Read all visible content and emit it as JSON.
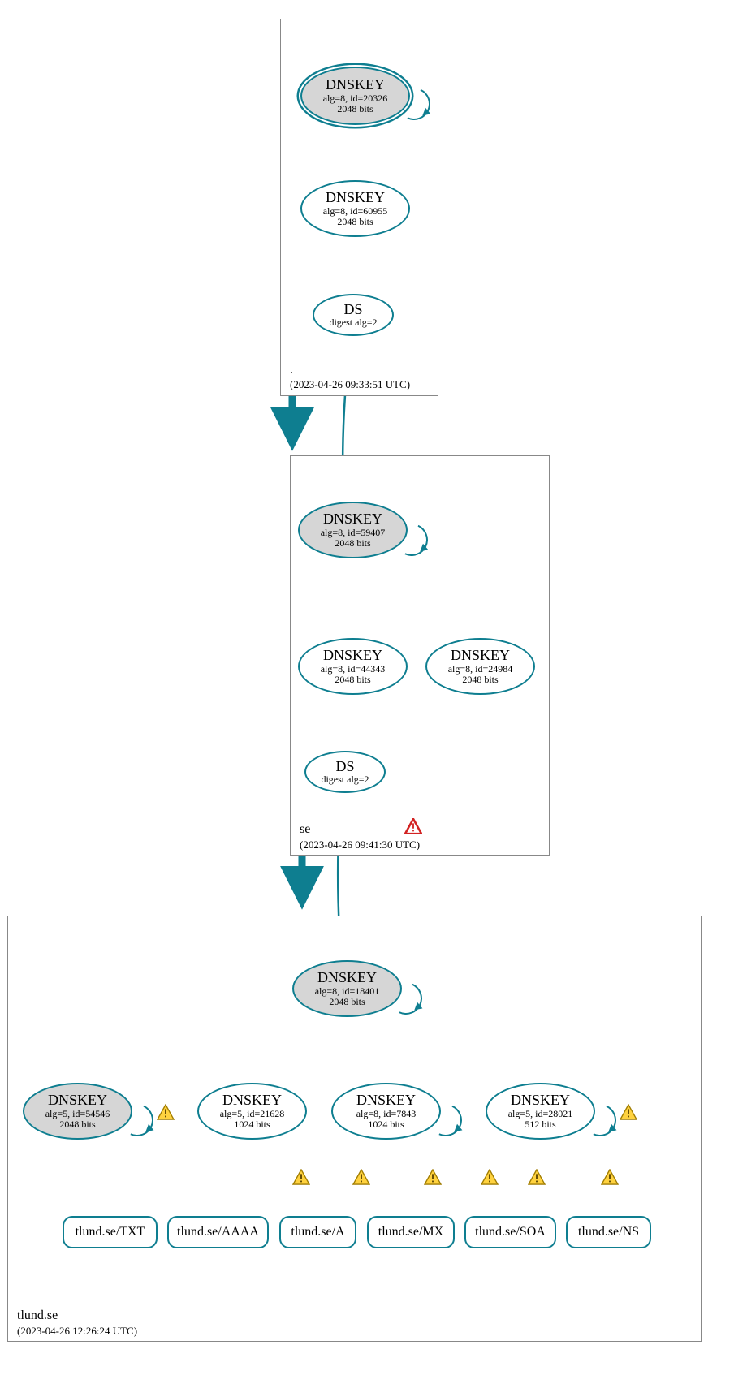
{
  "colors": {
    "edge": "#0e7e90",
    "zoneBorder": "#888888",
    "kskFill": "#d6d6d6",
    "warningFill": "#ffd23f",
    "warningStroke": "#a07c00",
    "errorStroke": "#d22222"
  },
  "zones": {
    "root": {
      "name": ".",
      "timestamp": "(2023-04-26 09:33:51 UTC)",
      "nodes": {
        "ksk": {
          "title": "DNSKEY",
          "line2": "alg=8, id=20326",
          "line3": "2048 bits"
        },
        "zsk": {
          "title": "DNSKEY",
          "line2": "alg=8, id=60955",
          "line3": "2048 bits"
        },
        "ds": {
          "title": "DS",
          "line2": "digest alg=2"
        }
      }
    },
    "se": {
      "name": "se",
      "timestamp": "(2023-04-26 09:41:30 UTC)",
      "nodes": {
        "ksk": {
          "title": "DNSKEY",
          "line2": "alg=8, id=59407",
          "line3": "2048 bits"
        },
        "zsk1": {
          "title": "DNSKEY",
          "line2": "alg=8, id=44343",
          "line3": "2048 bits"
        },
        "zsk2": {
          "title": "DNSKEY",
          "line2": "alg=8, id=24984",
          "line3": "2048 bits"
        },
        "ds": {
          "title": "DS",
          "line2": "digest alg=2"
        }
      }
    },
    "tlund": {
      "name": "tlund.se",
      "timestamp": "(2023-04-26 12:26:24 UTC)",
      "nodes": {
        "ksk": {
          "title": "DNSKEY",
          "line2": "alg=8, id=18401",
          "line3": "2048 bits"
        },
        "key1": {
          "title": "DNSKEY",
          "line2": "alg=5, id=54546",
          "line3": "2048 bits"
        },
        "key2": {
          "title": "DNSKEY",
          "line2": "alg=5, id=21628",
          "line3": "1024 bits"
        },
        "key3": {
          "title": "DNSKEY",
          "line2": "alg=8, id=7843",
          "line3": "1024 bits"
        },
        "key4": {
          "title": "DNSKEY",
          "line2": "alg=5, id=28021",
          "line3": "512 bits"
        }
      },
      "records": {
        "txt": "tlund.se/TXT",
        "aaaa": "tlund.se/AAAA",
        "a": "tlund.se/A",
        "mx": "tlund.se/MX",
        "soa": "tlund.se/SOA",
        "ns": "tlund.se/NS"
      }
    }
  }
}
